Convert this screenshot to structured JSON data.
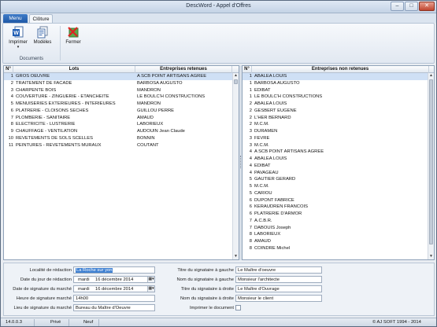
{
  "window": {
    "title": "DescWord - Appel d'Offres"
  },
  "tabs": {
    "menu": "Menu",
    "cloture": "Clôture"
  },
  "ribbon": {
    "buttons": [
      {
        "label": "Imprimer",
        "icon": "word-doc-icon"
      },
      {
        "label": "Modèles",
        "icon": "templates-icon"
      },
      {
        "label": "Fermer",
        "icon": "close-folder-icon"
      }
    ],
    "group_label": "Documents"
  },
  "left_table": {
    "headers": {
      "num": "N°",
      "lots": "Lots",
      "entreprises": "Entreprises retenues"
    },
    "rows": [
      {
        "num": "1",
        "lot": "GROS OEUVRE",
        "ent": "A SCB POINT ARTISANS AGREE"
      },
      {
        "num": "2",
        "lot": "TRAITEMENT DE FACADE",
        "ent": "BARBOSA AUGUSTO"
      },
      {
        "num": "3",
        "lot": "CHARPENTE BOIS",
        "ent": "MANDRON"
      },
      {
        "num": "4",
        "lot": "COUVERTURE - ZINGUERIE - ETANCHEITE",
        "ent": "LE BOULC'H CONSTRUCTIONS"
      },
      {
        "num": "5",
        "lot": "MENUISERIES EXTERIEURES - INTERIEURES",
        "ent": "MANDRON"
      },
      {
        "num": "6",
        "lot": "PLATRERIE - CLOISONS SECHES",
        "ent": "GUILLOU PERRE"
      },
      {
        "num": "7",
        "lot": "PLOMBERIE - SANITAIRE",
        "ent": "AMAUD"
      },
      {
        "num": "8",
        "lot": "ELECTRICITE - LUSTRERIE",
        "ent": "LABORIEUX"
      },
      {
        "num": "9",
        "lot": "CHAUFFAGE - VENTILATION",
        "ent": "AUDOUIN Jean Claude"
      },
      {
        "num": "10",
        "lot": "REVETEMENTS DE SOLS SCELLES",
        "ent": "BONNIN"
      },
      {
        "num": "11",
        "lot": "PEINTURES - REVETEMENTS MURAUX",
        "ent": "COUTANT"
      }
    ]
  },
  "right_table": {
    "headers": {
      "num": "N°",
      "entreprises": "Entreprises non retenues"
    },
    "rows": [
      {
        "num": "1",
        "ent": "ABALEA LOUIS"
      },
      {
        "num": "1",
        "ent": "BARBOSA AUGUSTO"
      },
      {
        "num": "1",
        "ent": "EDIBAT"
      },
      {
        "num": "1",
        "ent": "LE BOULC'H CONSTRUCTIONS"
      },
      {
        "num": "2",
        "ent": "ABALEA LOUIS"
      },
      {
        "num": "2",
        "ent": "GESBERT EUGENE"
      },
      {
        "num": "2",
        "ent": "L'HER BERNARD"
      },
      {
        "num": "2",
        "ent": "M.C.M."
      },
      {
        "num": "3",
        "ent": "DURAMEN"
      },
      {
        "num": "3",
        "ent": "FEVRE"
      },
      {
        "num": "3",
        "ent": "M.C.M."
      },
      {
        "num": "4",
        "ent": "A SCB POINT ARTISANS AGREE"
      },
      {
        "num": "4",
        "ent": "ABALEA LOUIS"
      },
      {
        "num": "4",
        "ent": "EDIBAT"
      },
      {
        "num": "4",
        "ent": "PAVAGEAU"
      },
      {
        "num": "5",
        "ent": "GAUTIER GERARD"
      },
      {
        "num": "5",
        "ent": "M.C.M."
      },
      {
        "num": "5",
        "ent": "CARIOU"
      },
      {
        "num": "6",
        "ent": "DUPONT FABRICE"
      },
      {
        "num": "6",
        "ent": "KERAUDREN FRANCOIS"
      },
      {
        "num": "6",
        "ent": "PLATRERIE D'ARMOR"
      },
      {
        "num": "7",
        "ent": "A.C.B.R."
      },
      {
        "num": "7",
        "ent": "DABOUIS Joseph"
      },
      {
        "num": "8",
        "ent": "LABORIEUX"
      },
      {
        "num": "8",
        "ent": "AMAUD"
      },
      {
        "num": "8",
        "ent": "COINDRE Michel"
      }
    ]
  },
  "form": {
    "localite": {
      "label": "Localité de rédaction",
      "value": "La Roche sur yon"
    },
    "date_redaction": {
      "label": "Date du jour de rédaction",
      "day": "mardi",
      "date": "16 décembre 2014"
    },
    "date_signature": {
      "label": "Date de signature du marché",
      "day": "mardi",
      "date": "16 décembre 2014"
    },
    "heure_signature": {
      "label": "Heure de signature marché",
      "value": "14h00"
    },
    "lieu_signature": {
      "label": "Lieu de signature du marché",
      "value": "Bureau du Maître d'Oeuvre"
    },
    "titre_gauche": {
      "label": "Titre du signataire à gauche",
      "value": "Le Maître d'oeuvre"
    },
    "nom_gauche": {
      "label": "Nom du signataire à gauche",
      "value": "Monsieur l'architecte"
    },
    "titre_droite": {
      "label": "Titre du signataire à droite",
      "value": "Le Maître d'Ouvrage"
    },
    "nom_droite": {
      "label": "Nom du signataire à droite",
      "value": "Monsieur le client"
    },
    "imprimer": {
      "label": "Imprimer le document"
    }
  },
  "status": {
    "version": "14.0.0.3",
    "prive": "Privé",
    "neuf": "Neuf",
    "copyright": "© AJ SOFT 1994 - 2014"
  },
  "colors": {
    "accent": "#1f58a6",
    "selection": "#cfe0f5",
    "highlight": "#3d7fd1"
  }
}
